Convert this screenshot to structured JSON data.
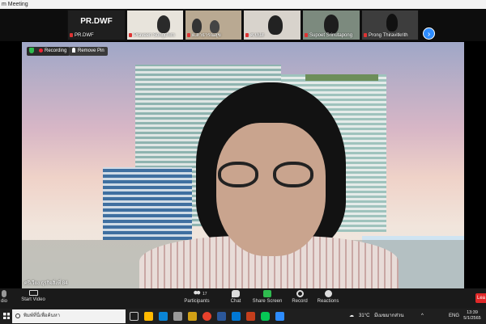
{
  "window": {
    "title": "m Meeting"
  },
  "thumbnails": [
    {
      "name": "PR.DWF",
      "style": "dark"
    },
    {
      "name": "Praveen Songchim",
      "style": "video"
    },
    {
      "name": "ฝ.สาธารณสุข",
      "style": "video"
    },
    {
      "name": "ศ.ปปส",
      "style": "video"
    },
    {
      "name": "Supoet Srinutapong",
      "style": "video"
    },
    {
      "name": "Prong Thiravitkrith",
      "style": "video"
    }
  ],
  "main_video": {
    "recording_label": "Recording",
    "remove_pin_label": "Remove Pin",
    "self_name": "ศรีเวียง ธุรกิจสิ่งที่ 84"
  },
  "toolbar": {
    "audio_label": "dio",
    "video_label": "Start Video",
    "participants_label": "Participants",
    "participants_count": "17",
    "chat_label": "Chat",
    "share_label": "Share Screen",
    "record_label": "Record",
    "reactions_label": "Reactions",
    "leave_label": "Lea"
  },
  "taskbar": {
    "search_placeholder": "พิมพ์ที่นี่เพื่อค้นหา",
    "temperature": "31°C",
    "weather_text": "มีเมฆมากส่วน",
    "language": "ENG",
    "time": "13:39",
    "date": "5/1/2565"
  },
  "colors": {
    "accent": "#2d8cff",
    "share_green": "#2fbb4f",
    "leave_red": "#e02828"
  }
}
